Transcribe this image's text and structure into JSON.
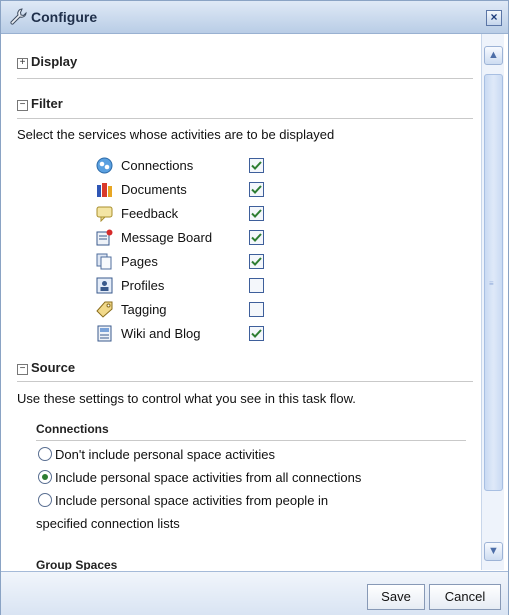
{
  "dialog": {
    "title": "Configure",
    "close_label": "×"
  },
  "sections": {
    "display": {
      "label": "Display",
      "toggle": "+"
    },
    "filter": {
      "label": "Filter",
      "toggle": "−",
      "description": "Select the services whose activities are to be displayed"
    },
    "source": {
      "label": "Source",
      "toggle": "−",
      "description": "Use these settings to control what you see in this task flow."
    }
  },
  "services": [
    {
      "label": "Connections",
      "icon": "connections-icon",
      "checked": true
    },
    {
      "label": "Documents",
      "icon": "documents-icon",
      "checked": true
    },
    {
      "label": "Feedback",
      "icon": "feedback-icon",
      "checked": true
    },
    {
      "label": "Message Board",
      "icon": "message-board-icon",
      "checked": true
    },
    {
      "label": "Pages",
      "icon": "pages-icon",
      "checked": true
    },
    {
      "label": "Profiles",
      "icon": "profiles-icon",
      "checked": false
    },
    {
      "label": "Tagging",
      "icon": "tagging-icon",
      "checked": false
    },
    {
      "label": "Wiki and Blog",
      "icon": "wiki-blog-icon",
      "checked": true
    }
  ],
  "connections": {
    "heading": "Connections",
    "options": [
      {
        "label": "Don't include personal space activities",
        "selected": false
      },
      {
        "label": "Include personal space activities from all connections",
        "selected": true
      },
      {
        "label_line1": "Include personal space activities from people in",
        "label_line2": "specified connection lists",
        "selected": false
      }
    ]
  },
  "group_spaces": {
    "heading": "Group Spaces"
  },
  "footer": {
    "save_label": "Save",
    "cancel_label": "Cancel"
  },
  "colors": {
    "title_bar": "#c7d7ec",
    "check": "#2e7d32",
    "footer": "#dfe8f5"
  }
}
